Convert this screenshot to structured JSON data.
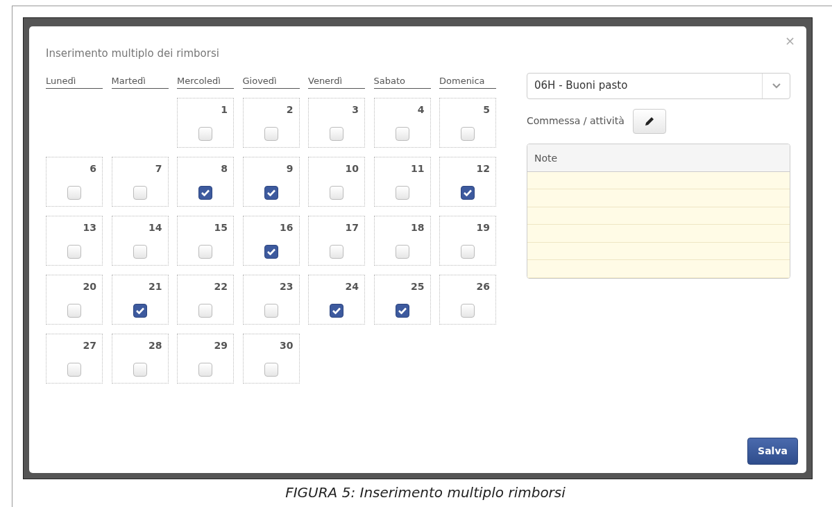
{
  "modal": {
    "title": "Inserimento multiplo dei rimborsi",
    "close": "×"
  },
  "weekdays": [
    "Lunedì",
    "Martedì",
    "Mercoledì",
    "Giovedì",
    "Venerdì",
    "Sabato",
    "Domenica"
  ],
  "weeks": [
    [
      {
        "kind": "blank"
      },
      {
        "kind": "blank"
      },
      {
        "kind": "day",
        "label": "1",
        "checked": false
      },
      {
        "kind": "day",
        "label": "2",
        "checked": false
      },
      {
        "kind": "day",
        "label": "3",
        "checked": false
      },
      {
        "kind": "day",
        "label": "4",
        "checked": false
      },
      {
        "kind": "day",
        "label": "5",
        "checked": false
      }
    ],
    [
      {
        "kind": "day",
        "label": "6",
        "checked": false
      },
      {
        "kind": "day",
        "label": "7",
        "checked": false
      },
      {
        "kind": "day",
        "label": "8",
        "checked": true
      },
      {
        "kind": "day",
        "label": "9",
        "checked": true
      },
      {
        "kind": "day",
        "label": "10",
        "checked": false
      },
      {
        "kind": "day",
        "label": "11",
        "checked": false
      },
      {
        "kind": "day",
        "label": "12",
        "checked": true
      }
    ],
    [
      {
        "kind": "day",
        "label": "13",
        "checked": false
      },
      {
        "kind": "day",
        "label": "14",
        "checked": false
      },
      {
        "kind": "day",
        "label": "15",
        "checked": false
      },
      {
        "kind": "day",
        "label": "16",
        "checked": true
      },
      {
        "kind": "day",
        "label": "17",
        "checked": false
      },
      {
        "kind": "day",
        "label": "18",
        "checked": false
      },
      {
        "kind": "day",
        "label": "19",
        "checked": false
      }
    ],
    [
      {
        "kind": "day",
        "label": "20",
        "checked": false
      },
      {
        "kind": "day",
        "label": "21",
        "checked": true
      },
      {
        "kind": "day",
        "label": "22",
        "checked": false
      },
      {
        "kind": "day",
        "label": "23",
        "checked": false
      },
      {
        "kind": "day",
        "label": "24",
        "checked": true
      },
      {
        "kind": "day",
        "label": "25",
        "checked": true
      },
      {
        "kind": "day",
        "label": "26",
        "checked": false
      }
    ],
    [
      {
        "kind": "day",
        "label": "27",
        "checked": false
      },
      {
        "kind": "day",
        "label": "28",
        "checked": false
      },
      {
        "kind": "day",
        "label": "29",
        "checked": false
      },
      {
        "kind": "day",
        "label": "30",
        "checked": false
      }
    ]
  ],
  "expense_type": {
    "value": "06H - Buoni pasto"
  },
  "commessa": {
    "label": "Commessa / attività"
  },
  "notes": {
    "header": "Note"
  },
  "save_button": "Salva",
  "caption": "FIGURA 5: Inserimento multiplo rimborsi"
}
